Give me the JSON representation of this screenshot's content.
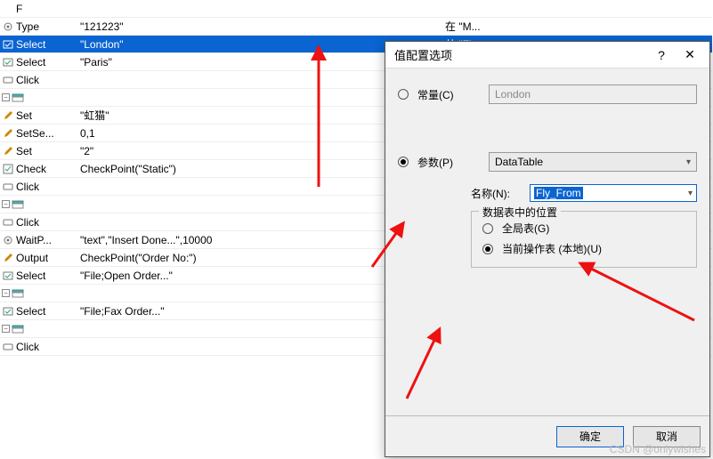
{
  "table": {
    "rows": [
      {
        "icon": "none",
        "label": "F",
        "value": "",
        "extra": ""
      },
      {
        "icon": "gear",
        "label": "Type",
        "value": "\"121223\"",
        "extra": "在 \"M..."
      },
      {
        "icon": "select",
        "label": "Select",
        "value": "\"London\"",
        "extra": "从 \"Fl",
        "selected": true
      },
      {
        "icon": "select",
        "label": "Select",
        "value": "\"Paris\"",
        "extra": ""
      },
      {
        "icon": "click",
        "label": "Click",
        "value": "",
        "extra": ""
      },
      {
        "icon": "header",
        "label": "",
        "value": "",
        "extra": ""
      },
      {
        "icon": "pen",
        "label": "Set",
        "value": "\"虹猫\"",
        "extra": ""
      },
      {
        "icon": "pen",
        "label": "SetSe...",
        "value": "0,1",
        "extra": ""
      },
      {
        "icon": "pen",
        "label": "Set",
        "value": "\"2\"",
        "extra": ""
      },
      {
        "icon": "check",
        "label": "Check",
        "value": "CheckPoint(\"Static\")",
        "extra": ""
      },
      {
        "icon": "click",
        "label": "Click",
        "value": "",
        "extra": ""
      },
      {
        "icon": "header",
        "label": "",
        "value": "",
        "extra": ""
      },
      {
        "icon": "click",
        "label": "Click",
        "value": "",
        "extra": ""
      },
      {
        "icon": "gear",
        "label": "WaitP...",
        "value": "\"text\",\"Insert Done...\",10000",
        "extra": ""
      },
      {
        "icon": "pen",
        "label": "Output",
        "value": "CheckPoint(\"Order No:\")",
        "extra": ""
      },
      {
        "icon": "select",
        "label": "Select",
        "value": "\"File;Open Order...\"",
        "extra": ""
      },
      {
        "icon": "header",
        "label": "",
        "value": "",
        "extra": ""
      },
      {
        "icon": "select",
        "label": "Select",
        "value": "\"File;Fax Order...\"",
        "extra": ""
      },
      {
        "icon": "header",
        "label": "",
        "value": "",
        "extra": ""
      },
      {
        "icon": "click",
        "label": "Click",
        "value": "",
        "extra": ""
      }
    ]
  },
  "dialog": {
    "title": "值配置选项",
    "help_btn": "?",
    "close_btn": "✕",
    "constant_label": "常量(C)",
    "constant_value": "London",
    "param_label": "参数(P)",
    "param_type": "DataTable",
    "name_label": "名称(N):",
    "name_value": "Fly_From",
    "group_title": "数据表中的位置",
    "global_label": "全局表(G)",
    "local_label": "当前操作表 (本地)(U)",
    "ok_label": "确定",
    "cancel_label": "取消"
  },
  "watermark": "CSDN @onlywishes"
}
